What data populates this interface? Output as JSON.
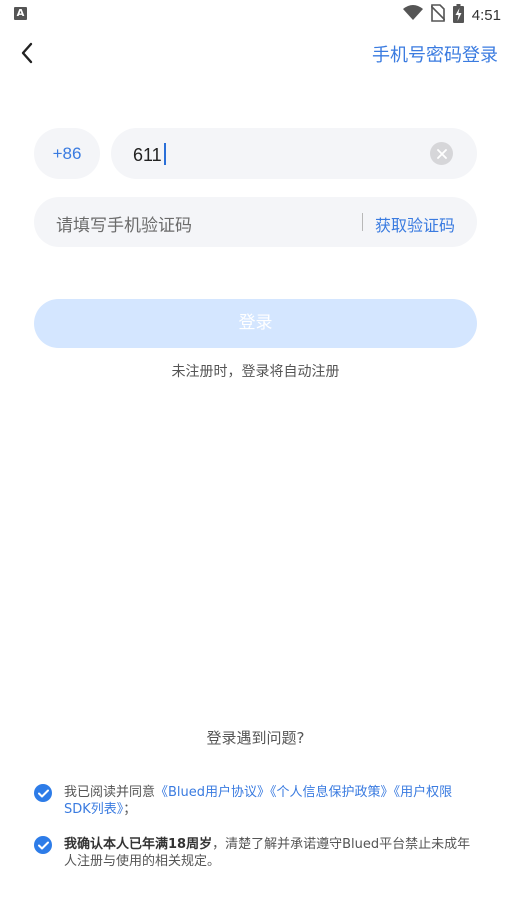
{
  "status_bar": {
    "left_icon_label": "A",
    "time": "4:51",
    "icons": [
      "wifi-icon",
      "no-sim-icon",
      "battery-charging-icon"
    ]
  },
  "header": {
    "back_icon": "chevron-left-icon",
    "switch_login_label": "手机号密码登录"
  },
  "form": {
    "country_code": "+86",
    "phone_value": "611",
    "code_placeholder": "请填写手机验证码",
    "get_code_label": "获取验证码",
    "login_label": "登录",
    "auto_register_note": "未注册时，登录将自动注册"
  },
  "footer": {
    "trouble_label": "登录遇到问题?",
    "agreement_1": {
      "prefix": "我已阅读并同意",
      "link_1": "《Blued用户协议》",
      "link_2": "《个人信息保护政策》",
      "link_3": "《用户权限 SDK列表》",
      "suffix": "；"
    },
    "agreement_2": {
      "strong": "我确认本人已年满18周岁",
      "rest": "，清楚了解并承诺遵守Blued平台禁止未成年人注册与使用的相关规定。"
    }
  },
  "colors": {
    "accent": "#3a7be0",
    "login_disabled": "#d4e6ff",
    "field_bg": "#f4f5f8",
    "checkbox": "#2d7ce8"
  }
}
